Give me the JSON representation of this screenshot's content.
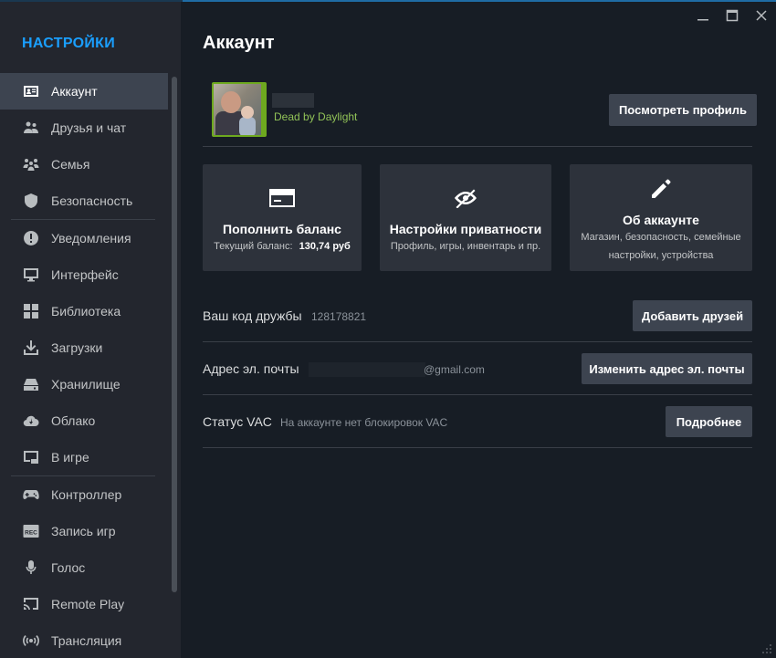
{
  "window": {
    "minimize": "—",
    "maximize": "☐",
    "close": "✕"
  },
  "sidebar": {
    "title": "НАСТРОЙКИ",
    "items": [
      {
        "label": "Аккаунт",
        "icon": "account-card-icon",
        "active": true
      },
      {
        "label": "Друзья и чат",
        "icon": "friends-icon"
      },
      {
        "label": "Семья",
        "icon": "family-icon"
      },
      {
        "label": "Безопасность",
        "icon": "shield-icon"
      },
      {
        "label": "Уведомления",
        "icon": "alert-icon"
      },
      {
        "label": "Интерфейс",
        "icon": "monitor-icon"
      },
      {
        "label": "Библиотека",
        "icon": "grid-icon"
      },
      {
        "label": "Загрузки",
        "icon": "download-icon"
      },
      {
        "label": "Хранилище",
        "icon": "storage-icon"
      },
      {
        "label": "Облако",
        "icon": "cloud-icon"
      },
      {
        "label": "В игре",
        "icon": "ingame-icon"
      },
      {
        "label": "Контроллер",
        "icon": "gamepad-icon"
      },
      {
        "label": "Запись игр",
        "icon": "rec-icon"
      },
      {
        "label": "Голос",
        "icon": "microphone-icon"
      },
      {
        "label": "Remote Play",
        "icon": "cast-icon"
      },
      {
        "label": "Трансляция",
        "icon": "broadcast-icon"
      }
    ]
  },
  "main": {
    "title": "Аккаунт",
    "profile": {
      "game_status": "Dead by Daylight",
      "view_profile_button": "Посмотреть профиль"
    },
    "cards": {
      "balance": {
        "title": "Пополнить баланс",
        "subtitle_label": "Текущий баланс:",
        "subtitle_value": "130,74 руб"
      },
      "privacy": {
        "title": "Настройки приватности",
        "subtitle": "Профиль, игры, инвентарь и пр."
      },
      "about": {
        "title": "Об аккаунте",
        "subtitle_line1": "Магазин, безопасность, семейные",
        "subtitle_line2": "настройки, устройства"
      }
    },
    "friend_code": {
      "label": "Ваш код дружбы",
      "value": "128178821",
      "button": "Добавить друзей"
    },
    "email": {
      "label": "Адрес эл. почты",
      "value": "@gmail.com",
      "button": "Изменить адрес эл. почты"
    },
    "vac": {
      "label": "Статус VAC",
      "value": "На аккаунте нет блокировок VAC",
      "button": "Подробнее"
    }
  },
  "colors": {
    "accent": "#1a9fff",
    "in_game": "#91c257",
    "background": "#171d25",
    "sidebar": "#23262e",
    "button": "#3d4450"
  }
}
